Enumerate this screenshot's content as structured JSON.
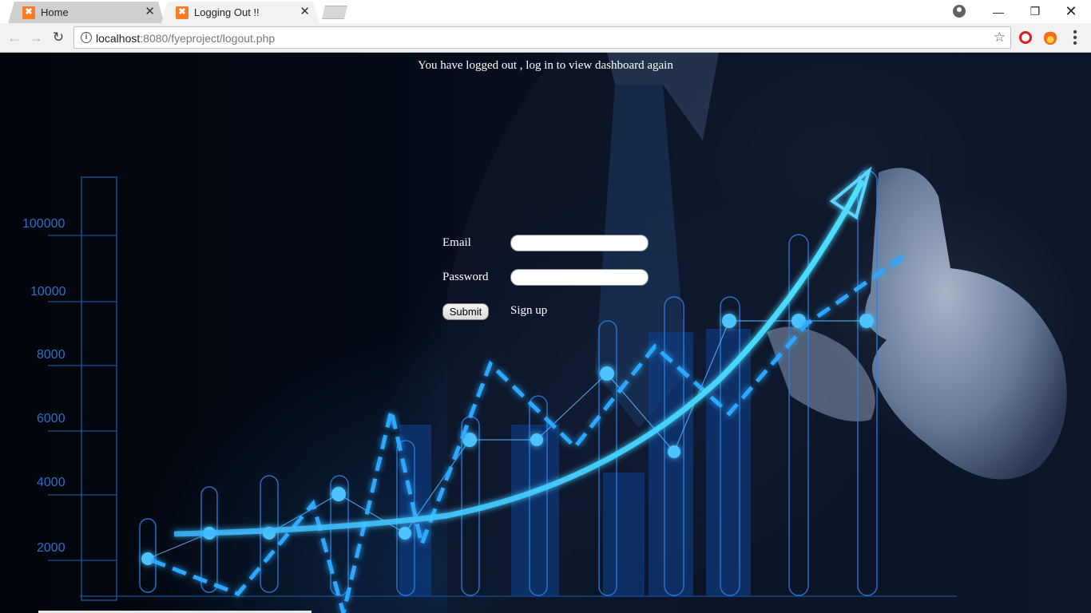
{
  "browser": {
    "tabs": [
      {
        "title": "Home",
        "active": false
      },
      {
        "title": "Logging Out !!",
        "active": true
      }
    ],
    "url_host": "localhost",
    "url_rest": ":8080/fyeproject/logout.php",
    "icons": {
      "back": "arrow-left-icon",
      "forward": "arrow-right-icon",
      "reload": "reload-icon",
      "info": "info-icon",
      "bookmark": "star-icon",
      "menu": "kebab-menu-icon"
    },
    "window_controls": [
      "minimize",
      "restore",
      "close"
    ]
  },
  "page": {
    "message": "You have logged out , log in to view dashboard again",
    "form": {
      "email_label": "Email",
      "email_value": "",
      "password_label": "Password",
      "password_value": "",
      "submit_label": "Submit",
      "signup_label": "Sign up"
    },
    "background_axis_labels": [
      "100000",
      "10000",
      "8000",
      "6000",
      "4000",
      "2000"
    ],
    "accent_color": "#1ea6ff"
  }
}
